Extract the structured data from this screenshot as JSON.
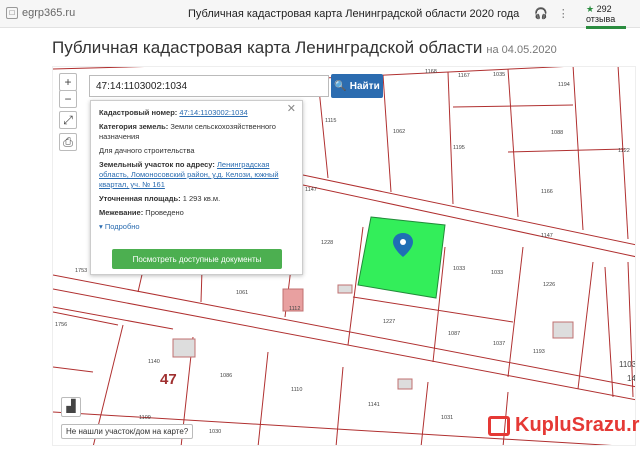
{
  "topbar": {
    "site": "egrp365.ru",
    "title": "Публичная кадастровая карта Ленинградской области 2020 года",
    "reviews_count": "292",
    "reviews_label": "отзыва"
  },
  "heading": {
    "title": "Публичная кадастровая карта Ленинградской области",
    "date": "на 04.05.2020"
  },
  "search": {
    "value": "47:14:1103002:1034",
    "button_label": "Найти"
  },
  "controls": {
    "zoom_in": "+",
    "zoom_out": "−"
  },
  "popup": {
    "cad_number_label": "Кадастровый номер:",
    "cad_number": "47:14:1103002:1034",
    "category_label": "Категория земель:",
    "category": "Земли сельскохозяйственного назначения",
    "use": "Для дачного строительства",
    "address_label": "Земельный участок по адресу:",
    "address": "Ленинградская область, Ломоносовский район, у.д. Келози, южный квартал, уч. № 161",
    "area_label": "Уточненная площадь:",
    "area": "1 293 кв.м.",
    "survey_label": "Межевание:",
    "survey": "Проведено",
    "more": "Подробно",
    "docs_button": "Посмотреть доступные документы"
  },
  "map": {
    "labels": {
      "l1168": "1168",
      "l1167": "1167",
      "l1194": "1194",
      "l1035": "1035",
      "l1115": "1115",
      "l1062": "1062",
      "l1195": "1195",
      "l1088": "1088",
      "l1122": "1122",
      "l1166": "1166",
      "l1147a": "1147",
      "l1147b": "1147",
      "l1228": "1228",
      "l1033a": "1033",
      "l1033b": "1033",
      "l1226": "1226",
      "l1753": "1753",
      "l1061": "1061",
      "l1112": "1112",
      "l1227": "1227",
      "l1087": "1087",
      "l1037": "1037",
      "l1193": "1193",
      "l1756": "1756",
      "l1140": "1140",
      "l1086": "1086",
      "l1110": "1110",
      "l1141": "1141",
      "l1031": "1031",
      "l1109": "1109",
      "l1030": "1030",
      "l1103": "1103",
      "l14": "14",
      "l47": "47"
    }
  },
  "not_found": "Не нашли участок/дом на карте?",
  "watermark": "KupluSrazu.ru",
  "colors": {
    "highlight": "#33ee5a",
    "accent_blue": "#2b6cb0",
    "docs_green": "#4caf50",
    "boundary": "#b03030"
  }
}
